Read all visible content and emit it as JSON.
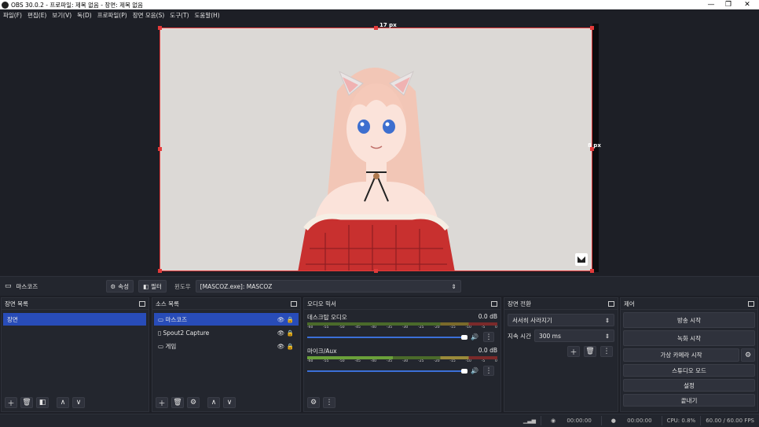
{
  "window": {
    "title": "OBS 30.0.2 - 프로파일: 제목 없음 - 장면: 제목 없음"
  },
  "menu": [
    "파일(F)",
    "편집(E)",
    "보기(V)",
    "독(D)",
    "프로파일(P)",
    "장면 모음(S)",
    "도구(T)",
    "도움말(H)"
  ],
  "preview": {
    "measure_top": "17 px",
    "measure_right": "8 px"
  },
  "source_bar": {
    "source_name": "마스코즈",
    "properties_label": "속성",
    "filters_label": "필터",
    "window_label": "윈도우",
    "window_value": "[MASCOZ.exe]: MASCOZ"
  },
  "scenes": {
    "title": "장면 목록",
    "items": [
      "장면"
    ]
  },
  "sources": {
    "title": "소스 목록",
    "items": [
      "마스코즈",
      "Spout2 Capture",
      "게임"
    ]
  },
  "mixer": {
    "title": "오디오 믹서",
    "channels": [
      {
        "name": "데스크탑 오디오",
        "db": "0.0 dB",
        "level": 0.0
      },
      {
        "name": "마이크/Aux",
        "db": "0.0 dB",
        "level": 0.78
      }
    ],
    "scale": [
      "-60",
      "-55",
      "-50",
      "-45",
      "-40",
      "-35",
      "-30",
      "-25",
      "-20",
      "-15",
      "-10",
      "-5",
      "0"
    ]
  },
  "transitions": {
    "title": "장면 전환",
    "type": "서서히 사라지기",
    "duration_label": "지속 시간",
    "duration_value": "300 ms"
  },
  "controls": {
    "title": "제어",
    "buttons": [
      "방송 시작",
      "녹화 시작",
      "가상 카메라 시작",
      "스튜디오 모드",
      "설정",
      "끝내기"
    ]
  },
  "status": {
    "stream_time": "00:00:00",
    "record_time": "00:00:00",
    "cpu": "CPU: 0.8%",
    "fps": "60.00 / 60.00 FPS"
  },
  "colors": {
    "accent": "#284cb8",
    "selection_border": "#e23a3a"
  }
}
